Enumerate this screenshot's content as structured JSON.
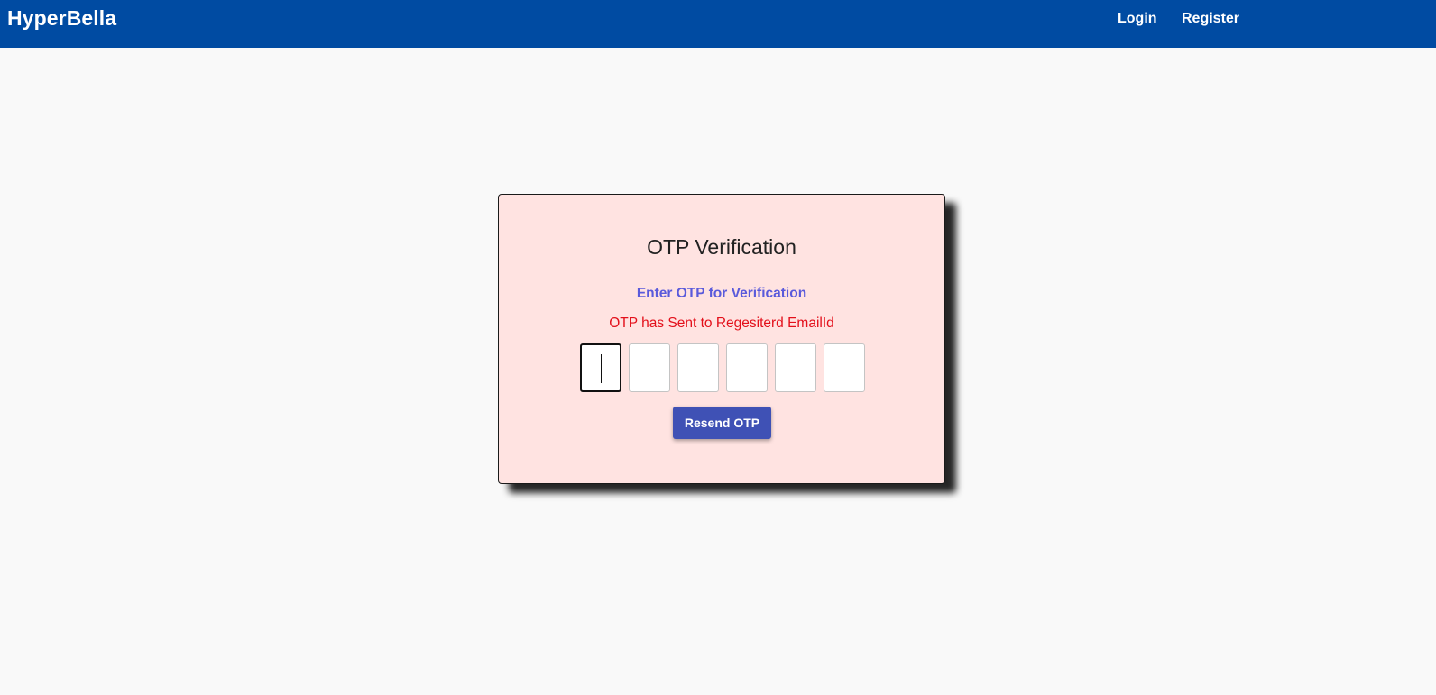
{
  "navbar": {
    "brand": "HyperBella",
    "links": [
      {
        "label": "Login"
      },
      {
        "label": "Register"
      }
    ],
    "background_color": "#004ba2"
  },
  "otp_card": {
    "title": "OTP Verification",
    "subtitle": "Enter OTP for Verification",
    "message": "OTP has Sent to Regesiterd EmailId",
    "otp_digits": [
      "",
      "",
      "",
      "",
      "",
      ""
    ],
    "resend_button_label": "Resend OTP",
    "background_color": "#ffe3e1",
    "subtitle_color": "#5a5adb",
    "message_color": "#e3101b",
    "button_color": "#3f51b5"
  }
}
